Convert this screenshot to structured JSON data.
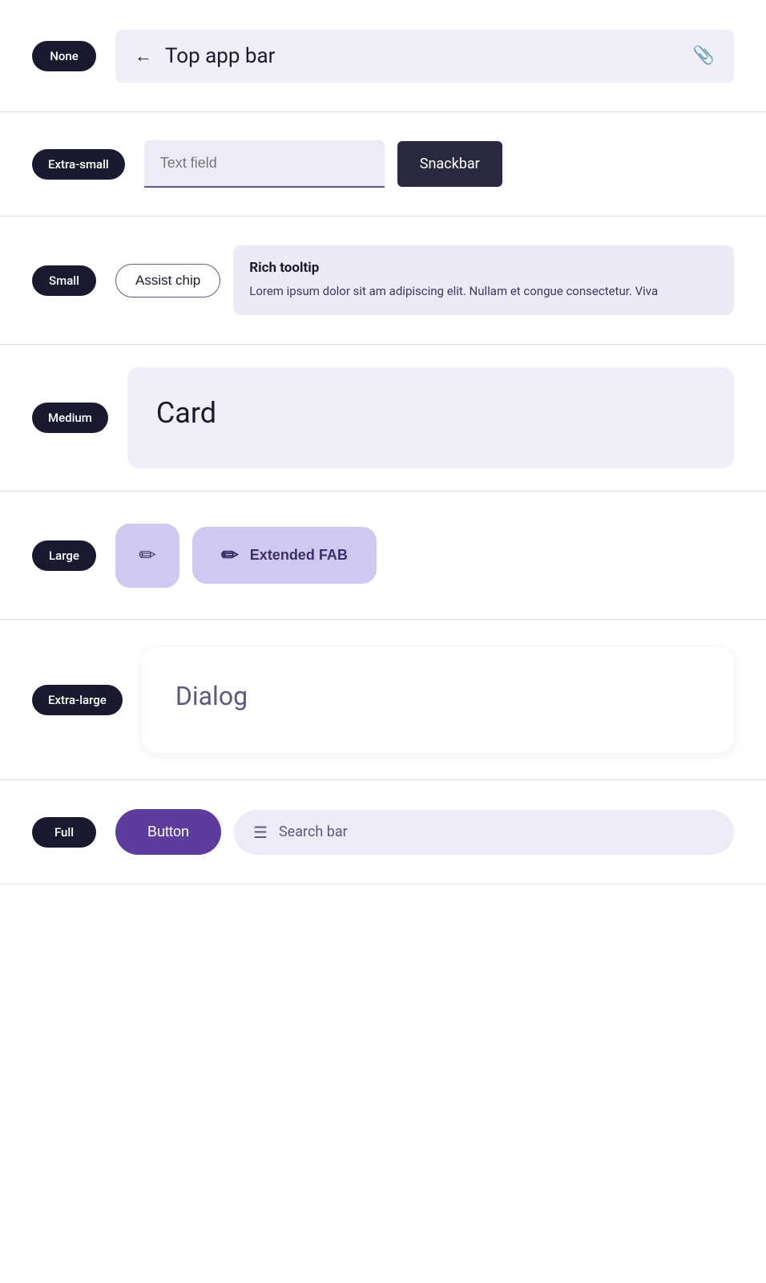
{
  "rows": [
    {
      "id": "none",
      "badge": "None",
      "components": {
        "top_app_bar": {
          "back_label": "←",
          "title": "Top app bar",
          "icon": "📎"
        }
      }
    },
    {
      "id": "extra-small",
      "badge": "Extra-small",
      "components": {
        "text_field": {
          "placeholder": "Text field"
        },
        "snackbar": {
          "label": "Snackbar"
        }
      }
    },
    {
      "id": "small",
      "badge": "Small",
      "components": {
        "assist_chip": {
          "label": "Assist chip"
        },
        "rich_tooltip": {
          "title": "Rich tooltip",
          "body": "Lorem ipsum dolor sit am adipiscing elit. Nullam et congue consectetur. Viva"
        }
      }
    },
    {
      "id": "medium",
      "badge": "Medium",
      "components": {
        "card": {
          "title": "Card"
        }
      }
    },
    {
      "id": "large",
      "badge": "Large",
      "components": {
        "fab": {
          "icon": "✏"
        },
        "extended_fab": {
          "icon": "✏",
          "label": "Extended FAB"
        }
      }
    },
    {
      "id": "extra-large",
      "badge": "Extra-large",
      "components": {
        "dialog": {
          "title": "Dialog"
        }
      }
    },
    {
      "id": "full",
      "badge": "Full",
      "components": {
        "button": {
          "label": "Button"
        },
        "search_bar": {
          "icon": "☰",
          "placeholder": "Search bar"
        }
      }
    }
  ]
}
